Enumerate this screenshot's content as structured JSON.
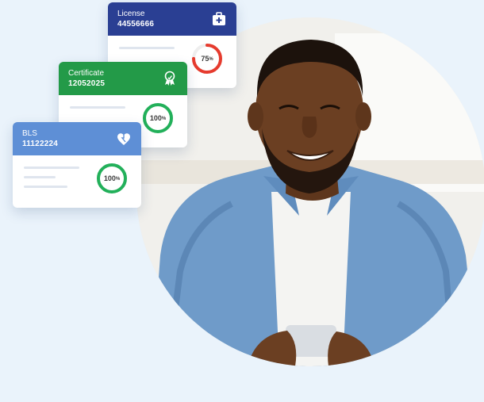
{
  "cards": [
    {
      "title": "License",
      "number": "44556666",
      "percent": "75",
      "pct_sign": "%",
      "progress": 0.75,
      "header_color": "#2a3f93",
      "ring_color": "#e63b2e",
      "icon": "medical-kit-icon"
    },
    {
      "title": "Certificate",
      "number": "12052025",
      "percent": "100",
      "pct_sign": "%",
      "progress": 1.0,
      "header_color": "#239a48",
      "ring_color": "#22b05a",
      "icon": "award-ribbon-icon"
    },
    {
      "title": "BLS",
      "number": "11122224",
      "percent": "100",
      "pct_sign": "%",
      "progress": 1.0,
      "header_color": "#5e8fd6",
      "ring_color": "#22b05a",
      "icon": "heart-pulse-icon"
    }
  ],
  "colors": {
    "background": "#eaf3fb",
    "shirt": "#6f9bc9",
    "skin": "#6b3f22"
  }
}
